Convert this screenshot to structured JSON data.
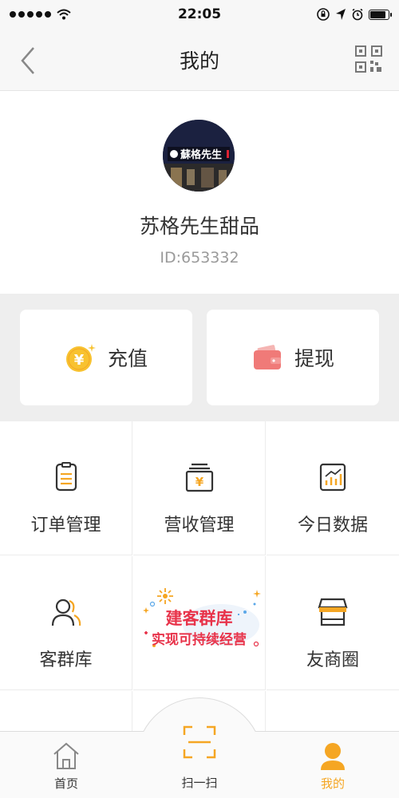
{
  "status_bar": {
    "time": "22:05",
    "signal_icon": "signal-dots-icon",
    "wifi_icon": "wifi-icon"
  },
  "nav": {
    "title": "我的",
    "back_icon": "chevron-left-icon",
    "qr_icon": "qr-code-icon"
  },
  "profile": {
    "name": "苏格先生甜品",
    "id_text": "ID:653332",
    "avatar_text": "蘇格先生"
  },
  "wallet": {
    "recharge_label": "充值",
    "recharge_icon": "yuan-coin-icon",
    "withdraw_label": "提现",
    "withdraw_icon": "wallet-icon"
  },
  "grid": {
    "items": [
      {
        "label": "订单管理",
        "icon": "order-list-icon"
      },
      {
        "label": "营收管理",
        "icon": "revenue-icon"
      },
      {
        "label": "今日数据",
        "icon": "chart-icon"
      },
      {
        "label": "客群库",
        "icon": "customers-icon"
      },
      {
        "label": "友商圈",
        "icon": "store-icon"
      }
    ],
    "banner": {
      "line1": "建客群库",
      "line2": "实现可持续经营"
    }
  },
  "tabbar": {
    "home_label": "首页",
    "scan_label": "扫一扫",
    "me_label": "我的"
  },
  "colors": {
    "accent": "#f5a623",
    "coin": "#f8c230",
    "wallet": "#f07a78",
    "promo": "#e8334a"
  }
}
